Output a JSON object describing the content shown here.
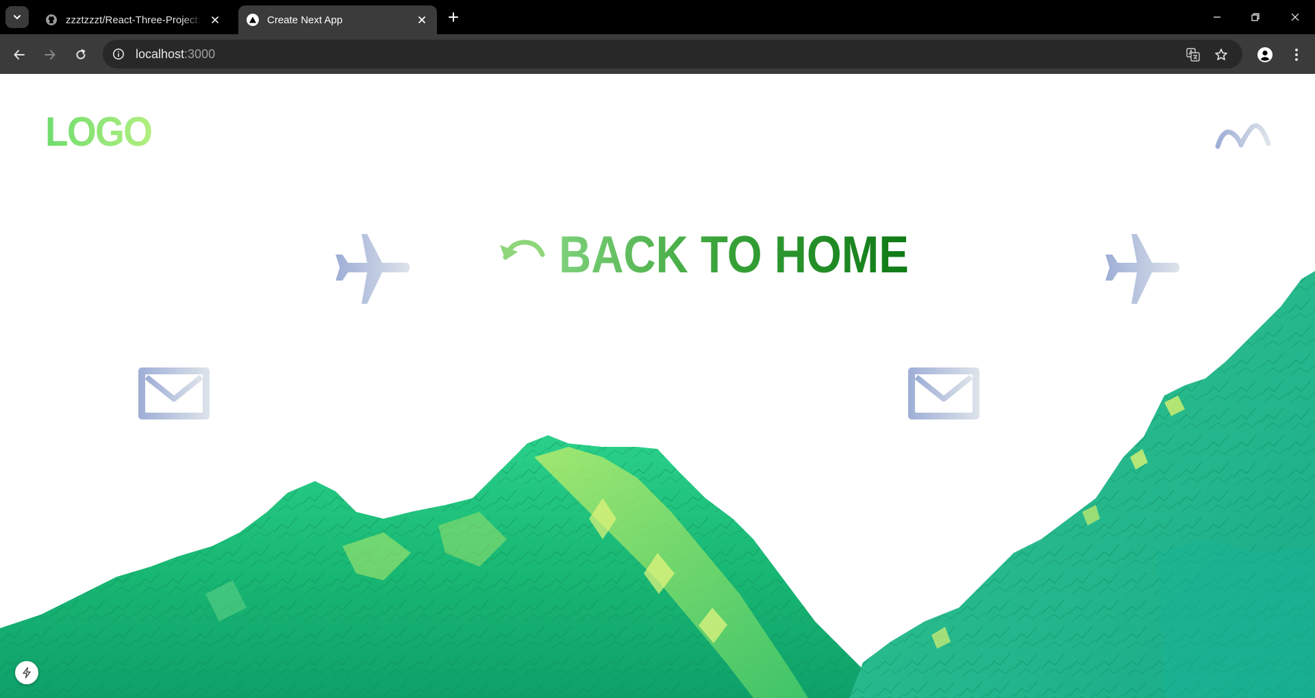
{
  "browser": {
    "tabs": [
      {
        "title": "zzztzzzt/React-Three-Project:",
        "favicon": "github-icon",
        "active": false
      },
      {
        "title": "Create Next App",
        "favicon": "nextjs-triangle-icon",
        "active": true
      }
    ],
    "address": {
      "host": "localhost",
      "port": ":3000"
    }
  },
  "page": {
    "logo_text": "LOGO",
    "back_home_label": "BACK TO HOME",
    "icons": [
      "plane-icon",
      "mail-icon",
      "undo-arrow-icon",
      "wave-brand-icon",
      "spark-icon"
    ],
    "colors": {
      "logo": "#8ee07a",
      "heading_start": "#7ed17a",
      "heading_end": "#0f7a16",
      "icon_start": "#9eaed6",
      "icon_end": "#dde3ea",
      "terrain": "#1fbf86"
    }
  }
}
